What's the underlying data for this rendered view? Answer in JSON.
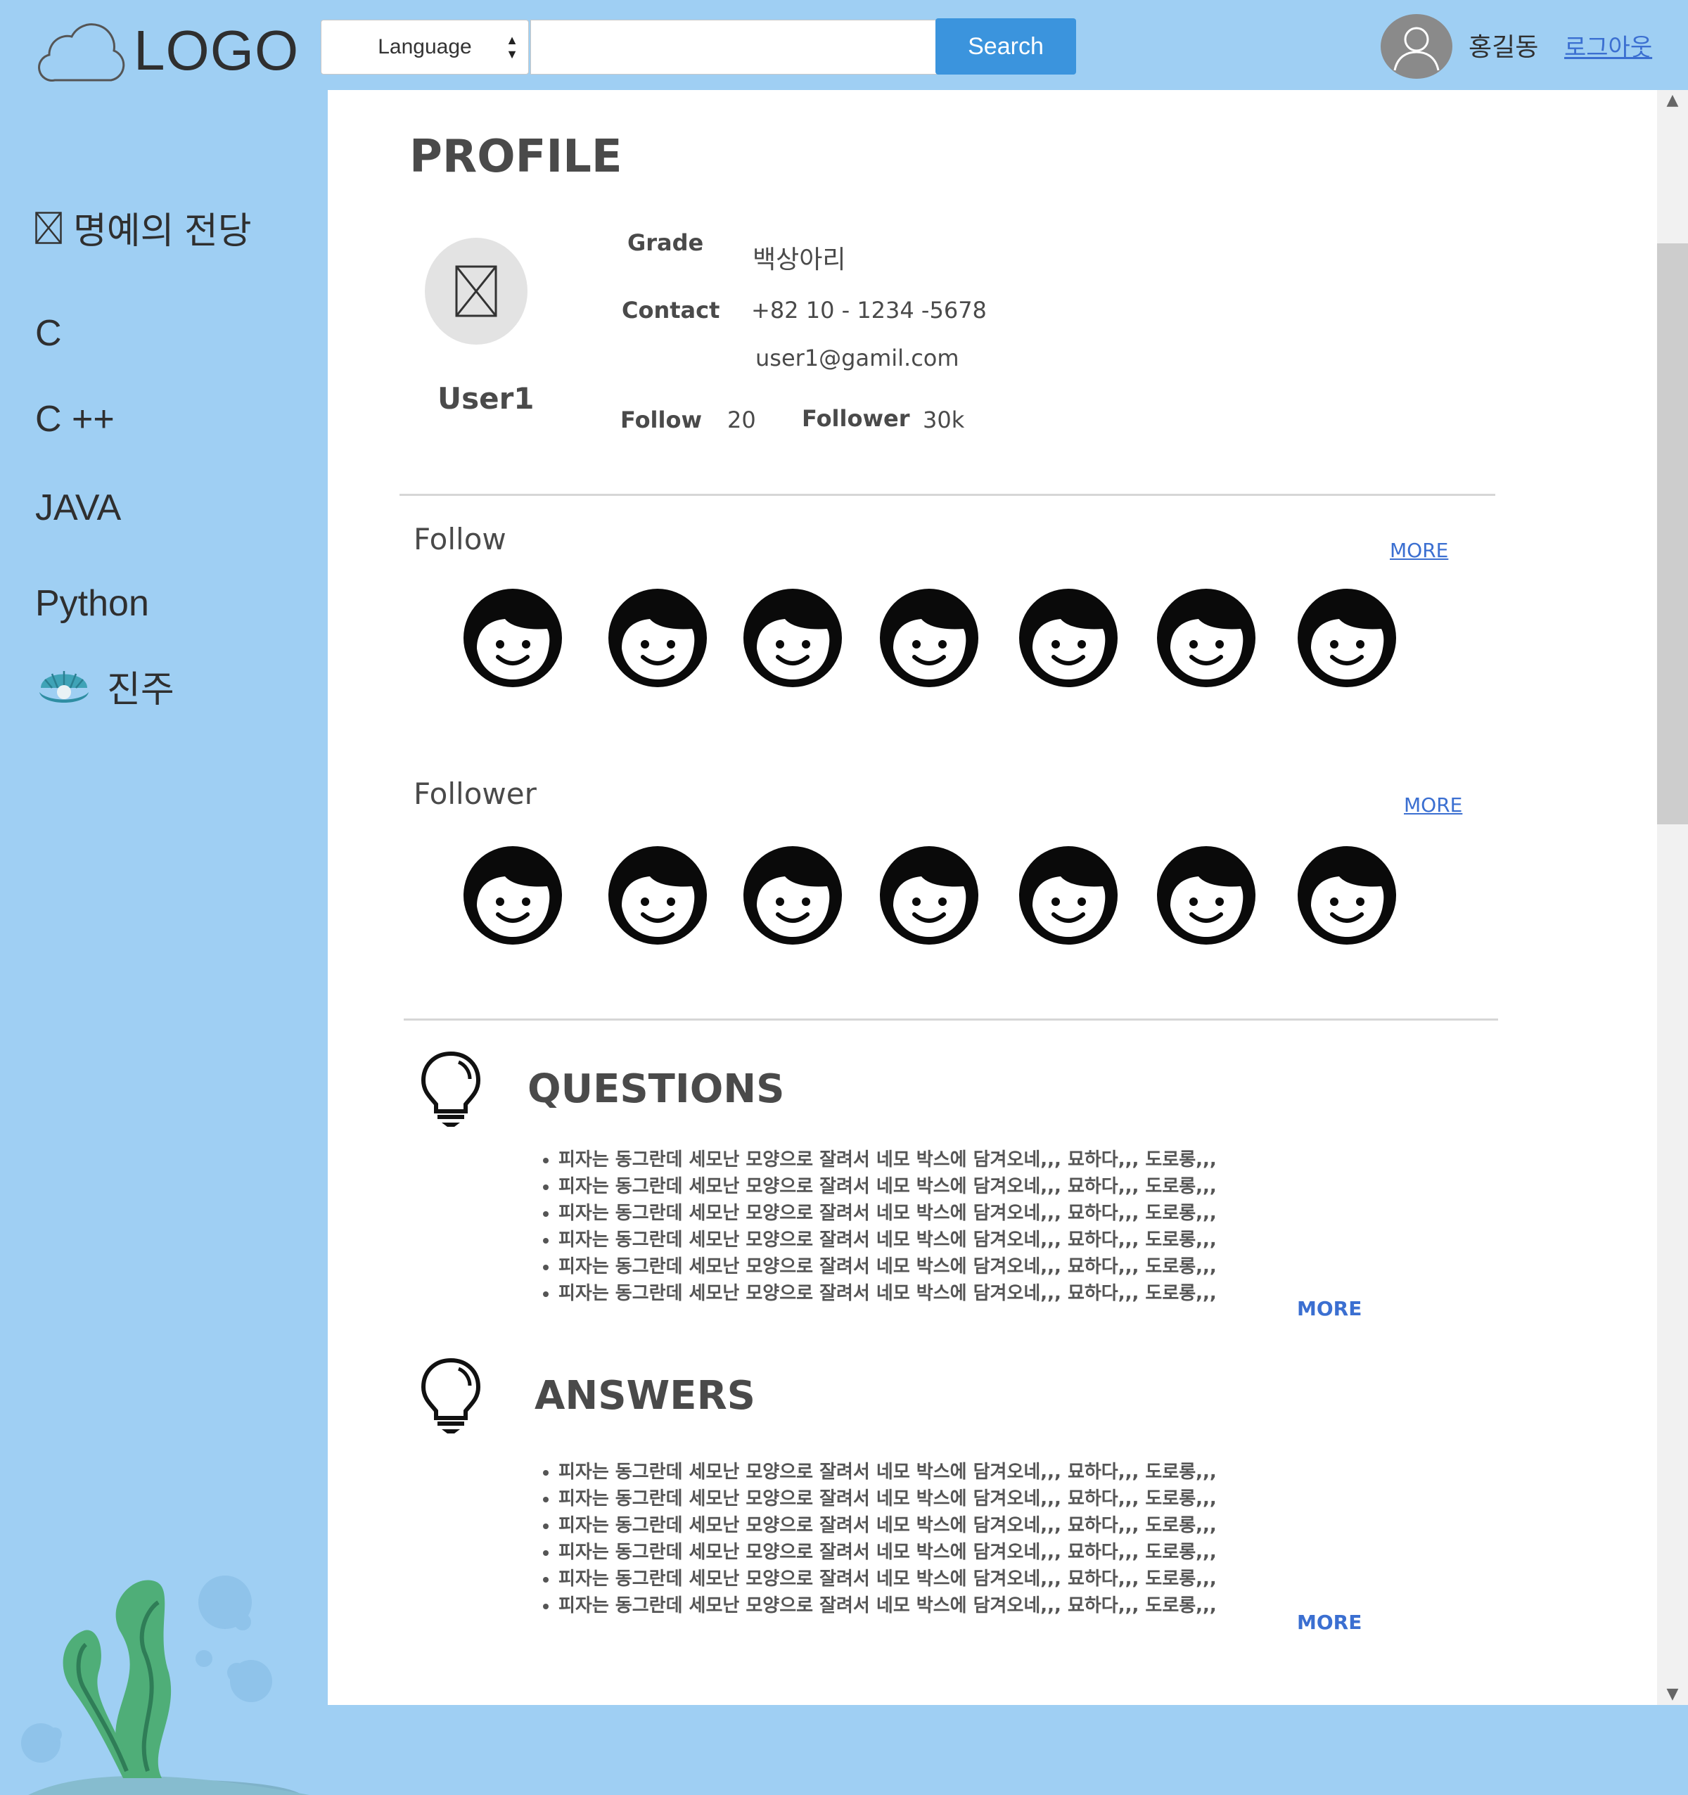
{
  "header": {
    "logo_text": "LOGO",
    "language_select": "Language",
    "search_value": "",
    "search_button": "Search",
    "user_name": "홍길동",
    "logout": "로그아웃"
  },
  "sidebar": {
    "items": [
      {
        "label": "명예의 전당",
        "icon": "image-placeholder-icon"
      },
      {
        "label": "C"
      },
      {
        "label": "C ++"
      },
      {
        "label": "JAVA"
      },
      {
        "label": "Python"
      },
      {
        "label": "진주",
        "icon": "pearl-shell-icon"
      }
    ]
  },
  "profile": {
    "title": "PROFILE",
    "name": "User1",
    "grade_label": "Grade",
    "grade_value": "백상아리",
    "contact_label": "Contact",
    "phone": "+82 10 - 1234 -5678",
    "email": "user1@gamil.com",
    "follow_label": "Follow",
    "follow_count": "20",
    "follower_label": "Follower",
    "follower_count": "30k"
  },
  "follow_section": {
    "label": "Follow",
    "more": "MORE",
    "faces": [
      "face-icon",
      "face-icon",
      "face-icon",
      "face-icon",
      "face-icon",
      "face-icon",
      "face-icon"
    ]
  },
  "follower_section": {
    "label": "Follower",
    "more": "MORE",
    "faces": [
      "face-icon",
      "face-icon",
      "face-icon",
      "face-icon",
      "face-icon",
      "face-icon",
      "face-icon"
    ]
  },
  "questions": {
    "title": "QUESTIONS",
    "items": [
      "피자는 동그란데 세모난 모양으로 잘려서 네모 박스에 담겨오네,,, 묘하다,,, 도로롱,,,",
      "피자는 동그란데 세모난 모양으로 잘려서 네모 박스에 담겨오네,,, 묘하다,,, 도로롱,,,",
      "피자는 동그란데 세모난 모양으로 잘려서 네모 박스에 담겨오네,,, 묘하다,,, 도로롱,,,",
      "피자는 동그란데 세모난 모양으로 잘려서 네모 박스에 담겨오네,,, 묘하다,,, 도로롱,,,",
      "피자는 동그란데 세모난 모양으로 잘려서 네모 박스에 담겨오네,,, 묘하다,,, 도로롱,,,",
      "피자는 동그란데 세모난 모양으로 잘려서 네모 박스에 담겨오네,,, 묘하다,,, 도로롱,,,"
    ],
    "more": "MORE"
  },
  "answers": {
    "title": "ANSWERS",
    "items": [
      "피자는 동그란데 세모난 모양으로 잘려서 네모 박스에 담겨오네,,, 묘하다,,, 도로롱,,,",
      "피자는 동그란데 세모난 모양으로 잘려서 네모 박스에 담겨오네,,, 묘하다,,, 도로롱,,,",
      "피자는 동그란데 세모난 모양으로 잘려서 네모 박스에 담겨오네,,, 묘하다,,, 도로롱,,,",
      "피자는 동그란데 세모난 모양으로 잘려서 네모 박스에 담겨오네,,, 묘하다,,, 도로롱,,,",
      "피자는 동그란데 세모난 모양으로 잘려서 네모 박스에 담겨오네,,, 묘하다,,, 도로롱,,,",
      "피자는 동그란데 세모난 모양으로 잘려서 네모 박스에 담겨오네,,, 묘하다,,, 도로롱,,,"
    ],
    "more": "MORE"
  },
  "colors": {
    "background": "#9fcff3",
    "search_button": "#3b94dd",
    "link": "#3b6fd1"
  }
}
